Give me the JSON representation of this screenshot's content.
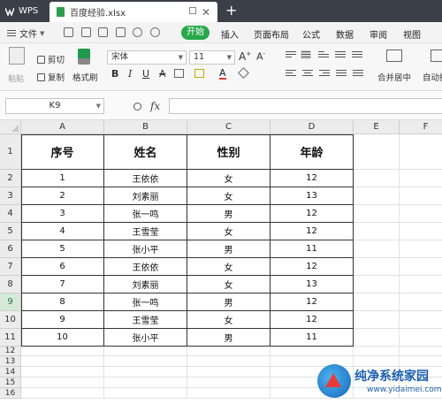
{
  "titlebar": {
    "app_name": "WPS",
    "file_name": "百度经验.xlsx",
    "close_glyph": "✕",
    "add_glyph": "+"
  },
  "menubar": {
    "file_label": "文件",
    "items": [
      "开始",
      "插入",
      "页面布局",
      "公式",
      "数据",
      "审阅",
      "视图"
    ]
  },
  "ribbon": {
    "paste_label": "粘贴",
    "cut_label": "剪切",
    "copy_label": "复制",
    "format_painter_label": "格式刷",
    "font_name": "宋体",
    "font_size": "11",
    "merge_label": "合并居中",
    "autowrap_label": "自动换"
  },
  "formula_bar": {
    "name_box": "K9",
    "fx_label": "fx",
    "formula": ""
  },
  "sheet": {
    "columns": [
      "A",
      "B",
      "C",
      "D",
      "E",
      "F"
    ],
    "rows": [
      "1",
      "2",
      "3",
      "4",
      "5",
      "6",
      "7",
      "8",
      "9",
      "10",
      "11",
      "12",
      "13",
      "14",
      "15",
      "16"
    ],
    "selected_row": "9",
    "headers": [
      "序号",
      "姓名",
      "性别",
      "年龄"
    ],
    "data": [
      [
        "1",
        "王依依",
        "女",
        "12"
      ],
      [
        "2",
        "刘素丽",
        "女",
        "13"
      ],
      [
        "3",
        "张一鸣",
        "男",
        "12"
      ],
      [
        "4",
        "王雪莹",
        "女",
        "12"
      ],
      [
        "5",
        "张小平",
        "男",
        "11"
      ],
      [
        "6",
        "王依依",
        "女",
        "12"
      ],
      [
        "7",
        "刘素丽",
        "女",
        "13"
      ],
      [
        "8",
        "张一鸣",
        "男",
        "12"
      ],
      [
        "9",
        "王雪莹",
        "女",
        "12"
      ],
      [
        "10",
        "张小平",
        "男",
        "11"
      ]
    ]
  },
  "watermark": {
    "brand": "纯净系统家园",
    "url": "www.yidaimei.com"
  },
  "colors": {
    "accent": "#27a84a",
    "titlebar": "#3b3f47",
    "selection": "#217346"
  }
}
